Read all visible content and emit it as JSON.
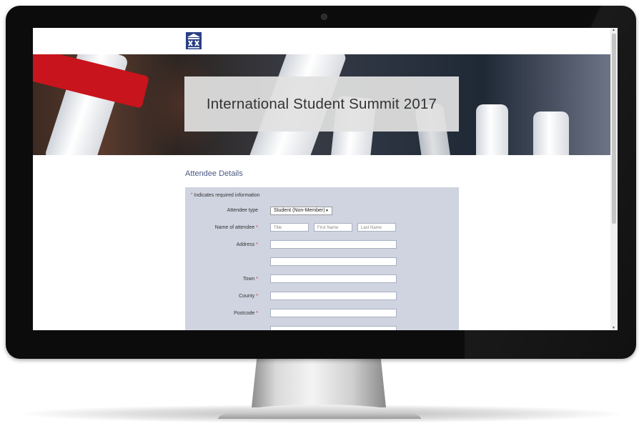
{
  "page": {
    "title": "International Student Summit 2017",
    "section_title": "Attendee Details",
    "required_note": "Indicates required information",
    "required_marker": "*"
  },
  "form": {
    "attendee_type": {
      "label": "Attendee type",
      "selected": "Student (Non-Member)"
    },
    "name": {
      "label": "Name of attendee",
      "placeholders": {
        "title": "Title",
        "first": "First Name",
        "last": "Last Name"
      }
    },
    "address_label": "Address",
    "town_label": "Town",
    "county_label": "County",
    "postcode_label": "Postcode"
  },
  "icons": {
    "logo": "institution-crest-logo",
    "select_arrow": "chevron-down-icon",
    "scroll_up": "scroll-up-arrow",
    "scroll_down": "scroll-down-arrow"
  },
  "colors": {
    "form_panel": "#cfd4e0",
    "section_title": "#4b5a84",
    "required": "#cc3333",
    "logo": "#2a3f86"
  }
}
